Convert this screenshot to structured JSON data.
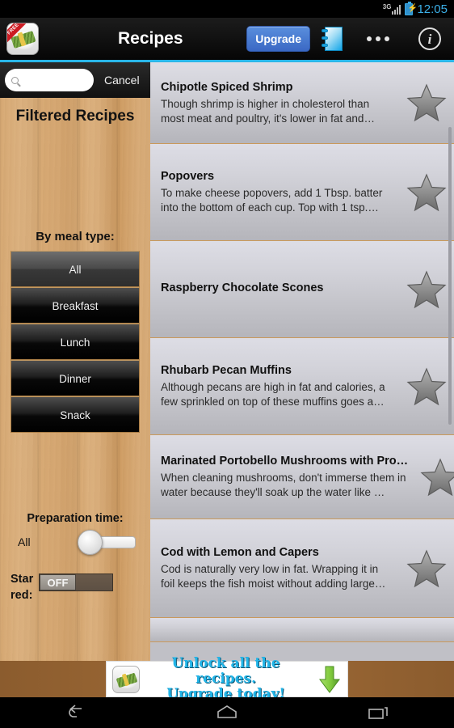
{
  "status_bar": {
    "network_label": "3G",
    "clock": "12:05",
    "battery_icon": "battery-charging-icon",
    "signal_icon": "signal-bars-icon",
    "clock_color": "#3cb0e8"
  },
  "action_bar": {
    "app_icon": "app-logo-icon",
    "app_icon_ribbon": "FREE",
    "title": "Recipes",
    "upgrade_label": "Upgrade",
    "notepad_icon": "notepad-icon",
    "overflow_icon": "overflow-menu-icon",
    "info_icon": "info-icon",
    "info_glyph": "i",
    "accent_color": "#29b6e8",
    "upgrade_color": "#3a68c4"
  },
  "sidebar": {
    "search": {
      "value": "",
      "placeholder": "",
      "icon": "search-icon"
    },
    "cancel_label": "Cancel",
    "panel_title": "Filtered Recipes",
    "meal_type_label": "By meal type:",
    "meal_buttons": [
      {
        "label": "All",
        "selected": true
      },
      {
        "label": "Breakfast",
        "selected": false
      },
      {
        "label": "Lunch",
        "selected": false
      },
      {
        "label": "Dinner",
        "selected": false
      },
      {
        "label": "Snack",
        "selected": false
      }
    ],
    "prep_time_label": "Preparation time:",
    "prep_time_value": "All",
    "starred_label": "Star\nred:",
    "starred_label_line1": "Star",
    "starred_label_line2": "red:",
    "starred_toggle_state": "OFF"
  },
  "recipes": [
    {
      "title": "Chipotle Spiced Shrimp",
      "desc": "Though shrimp is higher in cholesterol than most meat and poultry, it's lower in fat and…",
      "starred": false,
      "star_icon": "star-icon"
    },
    {
      "title": "Popovers",
      "desc": "To make cheese popovers, add 1 Tbsp. batter into the bottom of each cup. Top with 1 tsp.…",
      "starred": false,
      "star_icon": "star-icon"
    },
    {
      "title": "Raspberry Chocolate Scones",
      "desc": "",
      "starred": false,
      "star_icon": "star-icon"
    },
    {
      "title": "Rhubarb Pecan Muffins",
      "desc": "Although pecans are high in fat and calories, a few sprinkled on top of these muffins goes a…",
      "starred": false,
      "star_icon": "star-icon"
    },
    {
      "title": "Marinated Portobello Mushrooms with Pro…",
      "desc": "When cleaning mushrooms, don't immerse them in water because they'll soak up the water like …",
      "starred": false,
      "star_icon": "star-icon"
    },
    {
      "title": "Cod with Lemon and Capers",
      "desc": "Cod is naturally very low in fat. Wrapping it in foil keeps the fish moist without adding large…",
      "starred": false,
      "star_icon": "star-icon"
    }
  ],
  "ad": {
    "line1": "Unlock all the recipes.",
    "line2": "Upgrade today!",
    "icon": "app-logo-icon",
    "arrow_icon": "download-arrow-icon",
    "text_color": "#22b5e8",
    "arrow_color": "#8cd24a"
  },
  "nav_bar": {
    "back_icon": "back-icon",
    "home_icon": "home-icon",
    "recents_icon": "recent-apps-icon"
  }
}
